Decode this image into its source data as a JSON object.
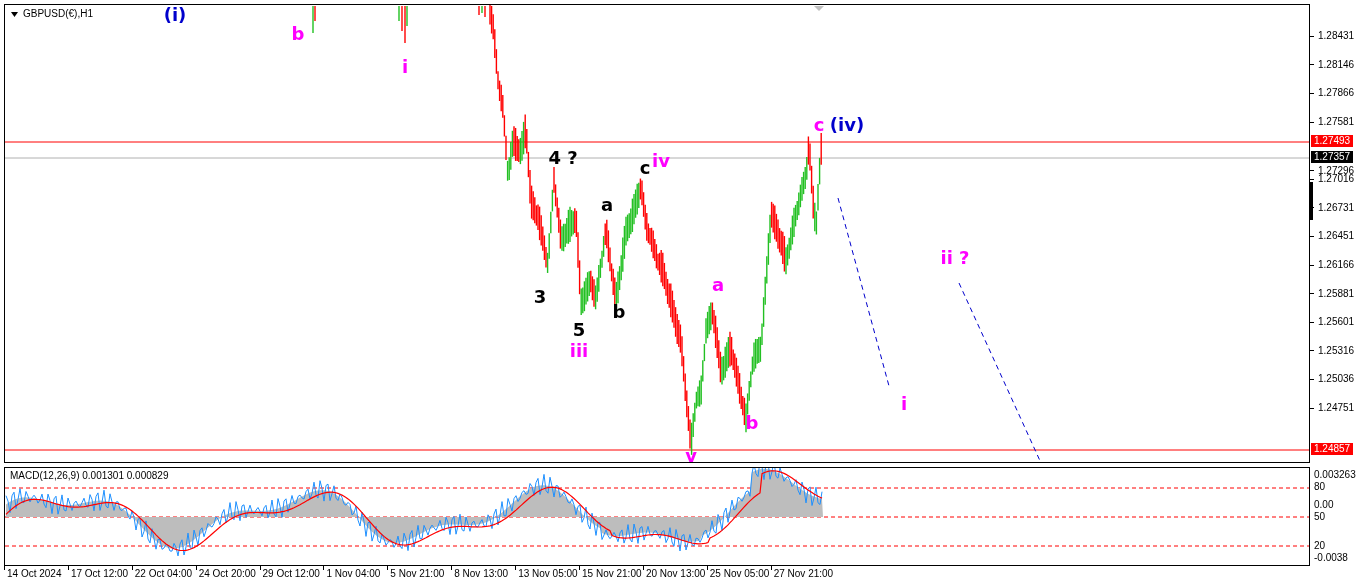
{
  "chart": {
    "title": "GBPUSD(€),H1",
    "price_axis": [
      "1.28431",
      "1.28146",
      "1.27866",
      "1.27581",
      "1.27296",
      "1.27016",
      "1.26731",
      "1.26451",
      "1.26166",
      "1.25881",
      "1.25601",
      "1.25316",
      "1.25036",
      "1.24751"
    ],
    "price_tags": [
      {
        "price": "1.27493",
        "kind": "level"
      },
      {
        "price": "1.27357",
        "kind": "bid"
      },
      {
        "price": "1.24857",
        "kind": "level"
      }
    ],
    "wave_labels": [
      {
        "text": "(i)",
        "color": "#0000cc"
      },
      {
        "text": "b",
        "color": "#ff00ff"
      },
      {
        "text": "i",
        "color": "#ff00ff"
      },
      {
        "text": "4 ?",
        "color": "#000000"
      },
      {
        "text": "c",
        "color": "#000000"
      },
      {
        "text": "iv",
        "color": "#ff00ff"
      },
      {
        "text": "a",
        "color": "#000000"
      },
      {
        "text": "3",
        "color": "#000000"
      },
      {
        "text": "5",
        "color": "#000000"
      },
      {
        "text": "b",
        "color": "#000000"
      },
      {
        "text": "iii",
        "color": "#ff00ff"
      },
      {
        "text": "a",
        "color": "#ff00ff"
      },
      {
        "text": "b",
        "color": "#ff00ff"
      },
      {
        "text": "v",
        "color": "#ff00ff"
      },
      {
        "text": "c",
        "color": "#ff00ff"
      },
      {
        "text": "(iv)",
        "color": "#0000cc"
      },
      {
        "text": "ii ?",
        "color": "#ff00ff"
      },
      {
        "text": "i",
        "color": "#ff00ff"
      }
    ]
  },
  "indicator": {
    "title": "MACD(12,26,9) 0.001301 0.000829",
    "axis": [
      "0.003263",
      "80",
      "0.00",
      "50",
      "20",
      "-0.0038"
    ]
  },
  "time_axis": [
    "14 Oct 2024",
    "17 Oct 12:00",
    "22 Oct 04:00",
    "24 Oct 20:00",
    "29 Oct 12:00",
    "1 Nov 04:00",
    "5 Nov 21:00",
    "8 Nov 13:00",
    "13 Nov 05:00",
    "15 Nov 21:00",
    "20 Nov 13:00",
    "25 Nov 05:00",
    "27 Nov 21:00"
  ]
}
